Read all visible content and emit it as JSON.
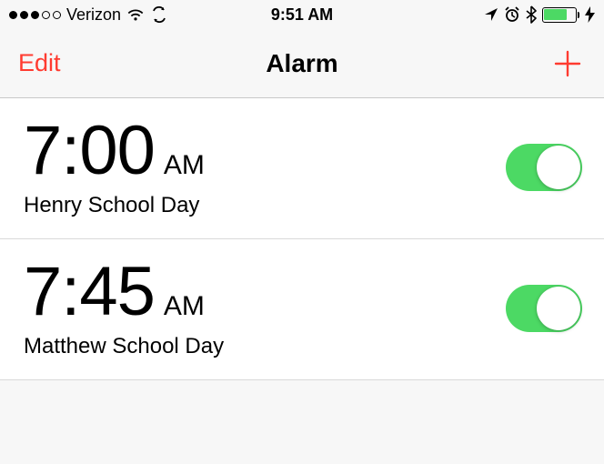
{
  "status": {
    "carrier": "Verizon",
    "time": "9:51 AM",
    "signal_strength": 3,
    "signal_max": 5
  },
  "nav": {
    "edit_label": "Edit",
    "title": "Alarm"
  },
  "alarms": [
    {
      "time": "7:00",
      "ampm": "AM",
      "label": "Henry School Day",
      "enabled": true
    },
    {
      "time": "7:45",
      "ampm": "AM",
      "label": "Matthew School Day",
      "enabled": true
    }
  ]
}
